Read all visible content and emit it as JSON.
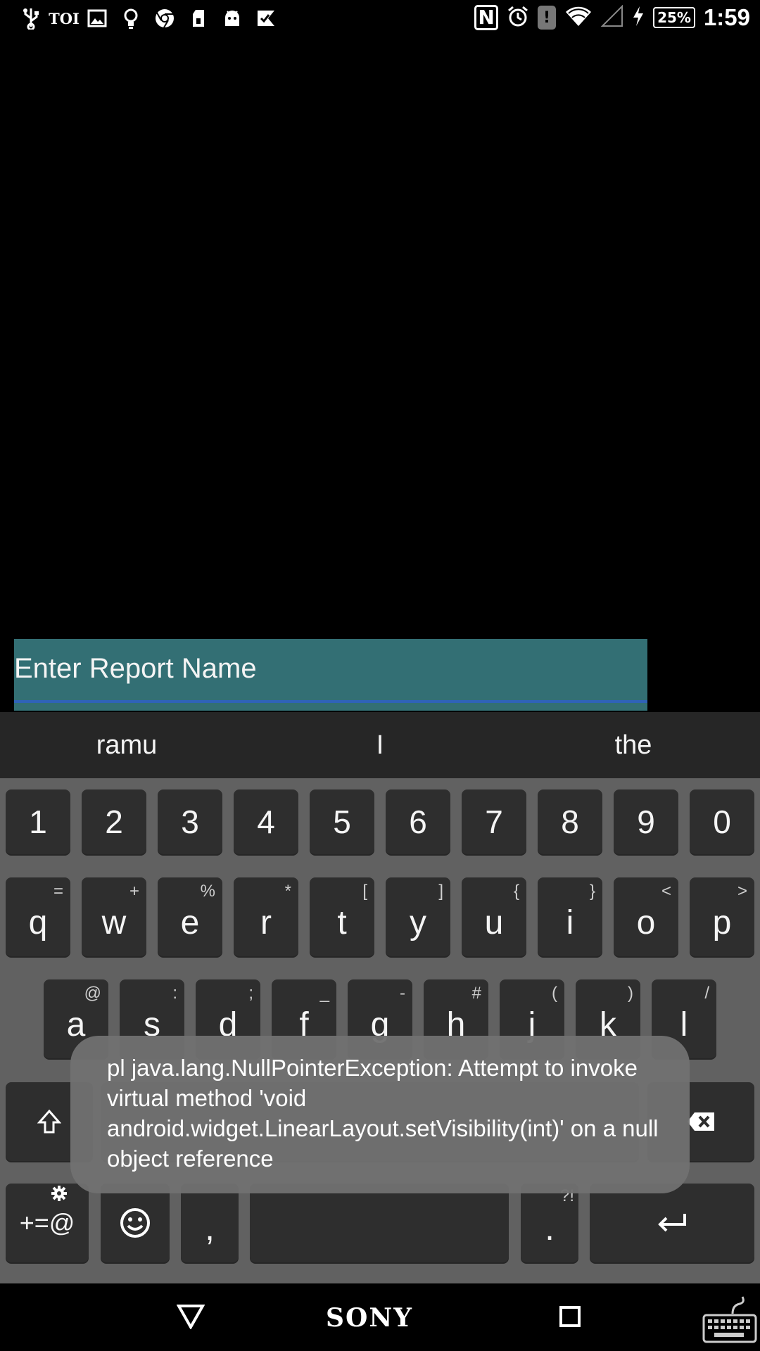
{
  "status_bar": {
    "left_icons": [
      "usb-icon",
      "toi-icon",
      "image-icon",
      "bulb-icon",
      "chrome-icon",
      "sd-card-icon",
      "android-icon",
      "checkmark-flag-icon"
    ],
    "toi_label": "TOI",
    "nfc_label": "N",
    "battery_level": "25%",
    "time": "1:59"
  },
  "report_field": {
    "placeholder": "Enter Report Name",
    "value": ""
  },
  "suggestions": [
    "ramu",
    "I",
    "the"
  ],
  "keyboard": {
    "number_row": [
      "1",
      "2",
      "3",
      "4",
      "5",
      "6",
      "7",
      "8",
      "9",
      "0"
    ],
    "row1": [
      {
        "key": "q",
        "hint": "="
      },
      {
        "key": "w",
        "hint": "+"
      },
      {
        "key": "e",
        "hint": "%"
      },
      {
        "key": "r",
        "hint": "*"
      },
      {
        "key": "t",
        "hint": "["
      },
      {
        "key": "y",
        "hint": "]"
      },
      {
        "key": "u",
        "hint": "{"
      },
      {
        "key": "i",
        "hint": "}"
      },
      {
        "key": "o",
        "hint": "<"
      },
      {
        "key": "p",
        "hint": ">"
      }
    ],
    "row2": [
      {
        "key": "a",
        "hint": "@"
      },
      {
        "key": "s",
        "hint": ":"
      },
      {
        "key": "d",
        "hint": ";"
      },
      {
        "key": "f",
        "hint": "_"
      },
      {
        "key": "g",
        "hint": "-"
      },
      {
        "key": "h",
        "hint": "#"
      },
      {
        "key": "j",
        "hint": "("
      },
      {
        "key": "k",
        "hint": ")"
      },
      {
        "key": "l",
        "hint": "/"
      }
    ],
    "symbols_key": "+=@",
    "comma_key": ",",
    "period_key": ".",
    "period_hint": "?!"
  },
  "toast": {
    "message": "pl java.lang.NullPointerException: Attempt to invoke virtual method 'void android.widget.LinearLayout.setVisibility(int)' on a null object reference"
  },
  "nav_bar": {
    "brand": "SONY"
  }
}
